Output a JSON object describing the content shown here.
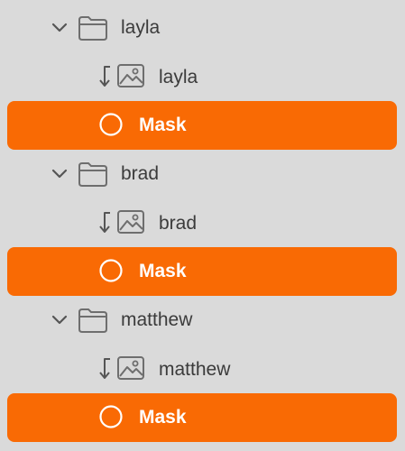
{
  "layers": {
    "groups": [
      {
        "folder_name": "layla",
        "image_name": "layla",
        "mask_label": "Mask"
      },
      {
        "folder_name": "brad",
        "image_name": "brad",
        "mask_label": "Mask"
      },
      {
        "folder_name": "matthew",
        "image_name": "matthew",
        "mask_label": "Mask"
      }
    ]
  },
  "colors": {
    "background": "#dadada",
    "selection": "#f96a04",
    "text": "#3b3b3b",
    "icon": "#6e6e6e"
  },
  "icons": {
    "disclosure": "chevron-down-icon",
    "group": "folder-icon",
    "clipping": "clip-arrow-icon",
    "image_layer": "image-icon",
    "mask": "circle-icon"
  }
}
